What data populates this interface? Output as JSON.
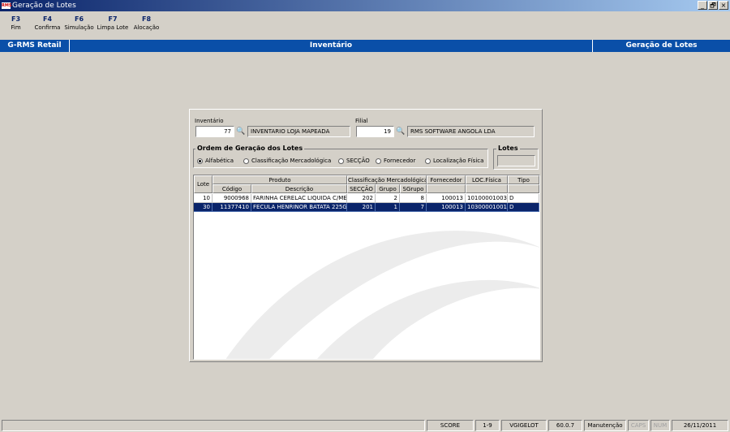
{
  "window": {
    "logo": "RMS",
    "title": "Geração de Lotes",
    "controls": [
      "_",
      "🗗",
      "×"
    ]
  },
  "toolbar": [
    {
      "key": "F3",
      "label": "Fim"
    },
    {
      "key": "F4",
      "label": "Confirma"
    },
    {
      "key": "F6",
      "label": "Simulação"
    },
    {
      "key": "F7",
      "label": "Limpa Lote"
    },
    {
      "key": "F8",
      "label": "Alocação"
    }
  ],
  "header": {
    "app": "G-RMS Retail",
    "module": "Inventário",
    "screen": "Geração de Lotes"
  },
  "form": {
    "inventario_label": "Inventário",
    "inventario_code": "77",
    "inventario_desc": "INVENTARIO LOJA MAPEADA",
    "filial_label": "Filial",
    "filial_code": "19",
    "filial_desc": "RMS SOFTWARE ANGOLA LDA",
    "ordem_title": "Ordem de Geração dos Lotes",
    "ordem_options": [
      "Alfabética",
      "Classificação Mercadológica",
      "SECÇÃO",
      "Fornecedor",
      "Localização Física"
    ],
    "ordem_selected": "Alfabética",
    "lotes_title": "Lotes",
    "lotes_value": ""
  },
  "grid": {
    "group_headers": {
      "lote": "Lote",
      "produto": "Produto",
      "classificacao": "Classificação Mercadológica",
      "fornecedor": "Fornecedor",
      "loc": "LOC.Física",
      "tipo": "Tipo"
    },
    "sub_headers": {
      "codigo": "Código",
      "descricao": "Descrição",
      "seccao": "SECÇÃO",
      "grupo": "Grupo",
      "sgrupo": "SGrupo"
    },
    "rows": [
      {
        "lote": "10",
        "codigo": "9000968",
        "descricao": "FARINHA CERELAC LIQUIDA C/ME",
        "seccao": "202",
        "grupo": "2",
        "sgrupo": "8",
        "fornecedor": "100013",
        "loc": "10100001003",
        "tipo": "D",
        "selected": false
      },
      {
        "lote": "30",
        "codigo": "11377410",
        "descricao": "FECULA HENRINOR BATATA 225G",
        "seccao": "201",
        "grupo": "1",
        "sgrupo": "7",
        "fornecedor": "100013",
        "loc": "10300001001",
        "tipo": "D",
        "selected": true
      }
    ]
  },
  "statusbar": {
    "message": "",
    "company": "SCORE",
    "range": "1-9",
    "program": "VGIGELOT",
    "version": "60.0.7",
    "mode": "Manutenção",
    "caps": "CAPS",
    "num": "NUM",
    "date": "26/11/2011"
  },
  "colors": {
    "header_blue": "#0a4fa8",
    "selection": "#0a246a",
    "window_bg": "#d4d0c8"
  }
}
